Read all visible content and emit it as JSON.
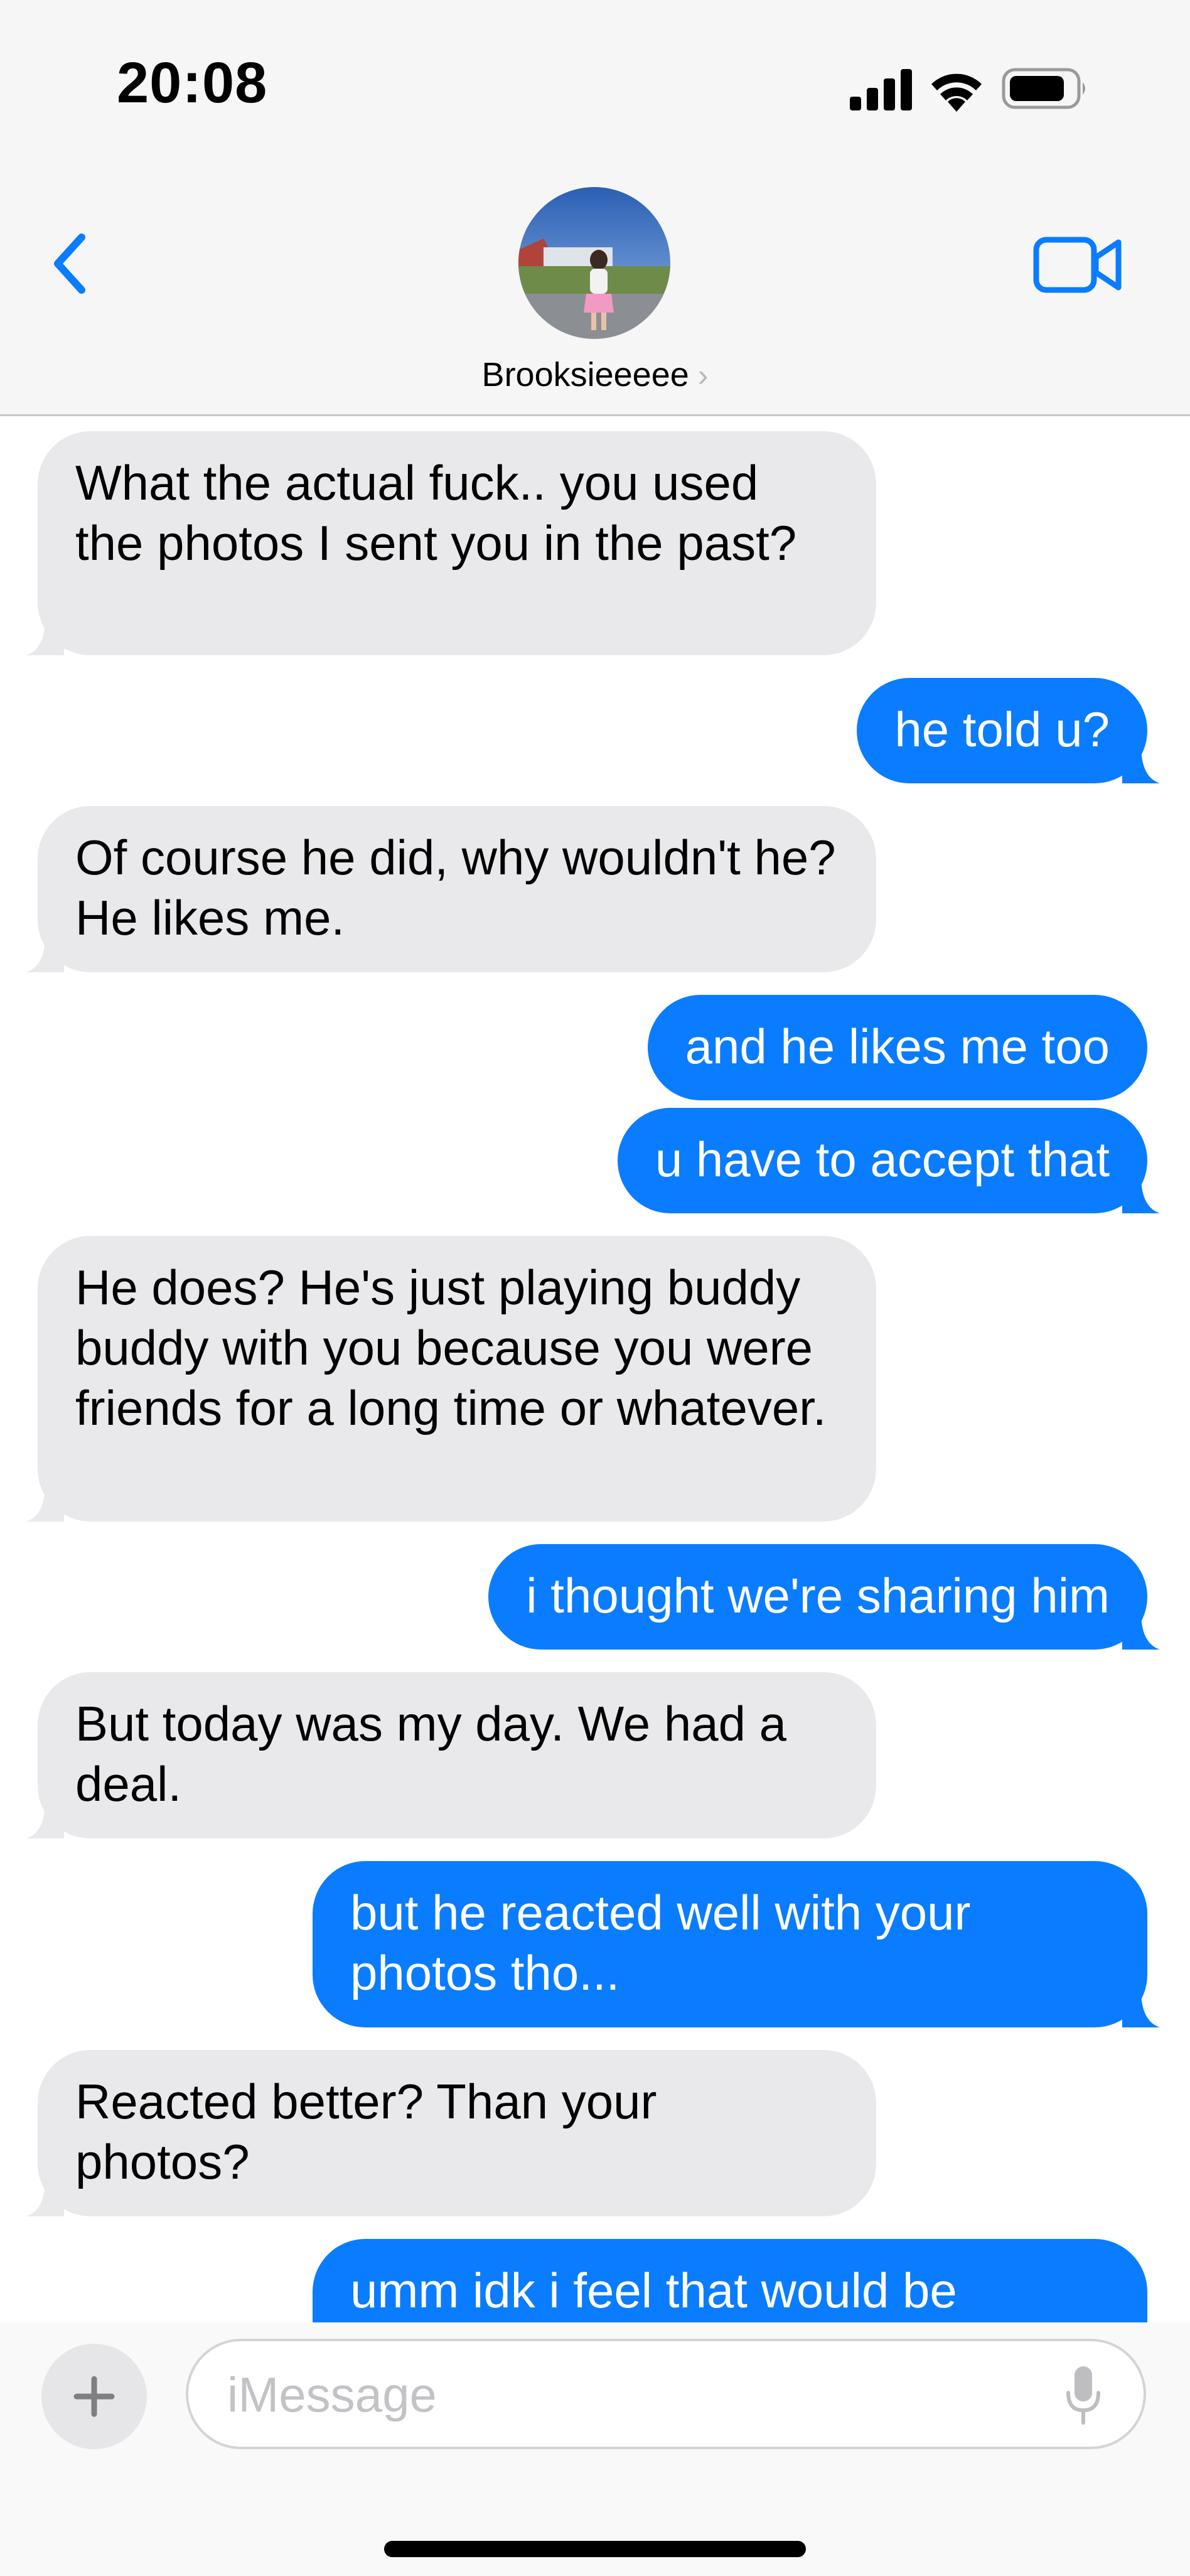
{
  "status_bar": {
    "time": "20:08",
    "signal_icon": "cellular-signal-icon",
    "wifi_icon": "wifi-icon",
    "battery_icon": "battery-icon"
  },
  "nav": {
    "back_icon": "chevron-left-icon",
    "contact_name": "Brooksieeeee",
    "contact_chevron": "›",
    "video_icon": "video-camera-icon",
    "avatar": "contact-avatar-photo"
  },
  "messages": [
    {
      "from": "them",
      "text": "What the actual fuck.. you used the photos I sent you in the past?"
    },
    {
      "from": "me",
      "text": "he told u?"
    },
    {
      "from": "them",
      "text": "Of course he did, why wouldn't he? He likes me."
    },
    {
      "from": "me",
      "text": "and he likes me too"
    },
    {
      "from": "me",
      "text": "u have to accept that"
    },
    {
      "from": "them",
      "text": "He does? He's just playing buddy buddy with you because you were friends for a long time or whatever."
    },
    {
      "from": "me",
      "text": "i thought we're sharing him"
    },
    {
      "from": "them",
      "text": "But today was my day. We had a deal."
    },
    {
      "from": "me",
      "text": "but he reacted well with your photos tho..."
    },
    {
      "from": "them",
      "text": "Reacted better? Than your photos?"
    },
    {
      "from": "me",
      "text": "umm idk i feel that would be"
    }
  ],
  "composer": {
    "plus_icon": "plus-icon",
    "placeholder": "iMessage",
    "value": "",
    "mic_icon": "microphone-icon"
  },
  "colors": {
    "outgoing_bubble": "#0a7cff",
    "incoming_bubble": "#e9e9eb",
    "accent": "#0a7cff",
    "header_bg": "#f6f6f6"
  }
}
